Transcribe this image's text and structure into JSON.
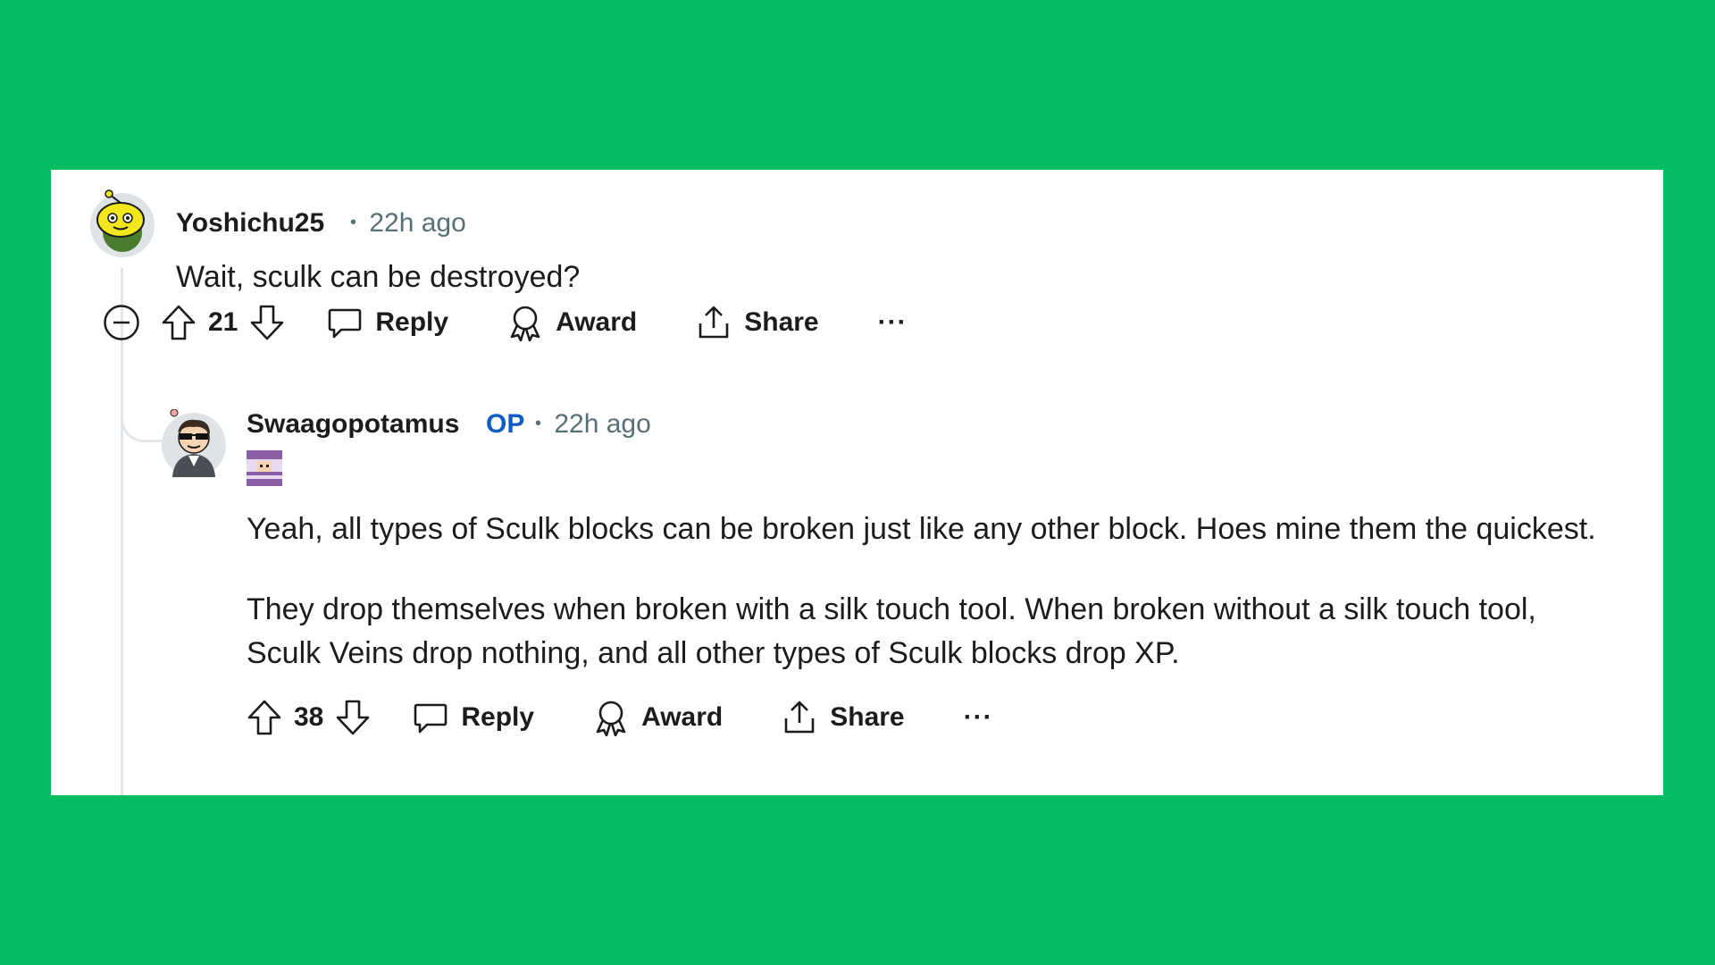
{
  "comments": [
    {
      "username": "Yoshichu25",
      "timestamp": "22h ago",
      "body": [
        "Wait, sculk can be destroyed?"
      ],
      "score": "21",
      "actions": {
        "reply": "Reply",
        "award": "Award",
        "share": "Share",
        "more": "···"
      }
    },
    {
      "username": "Swaagopotamus",
      "op_badge": "OP",
      "timestamp": "22h ago",
      "body": [
        "Yeah, all types of Sculk blocks can be broken just like any other block. Hoes mine them the quickest.",
        "They drop themselves when broken with a silk touch tool. When broken without a silk touch tool, Sculk Veins drop nothing, and all other types of Sculk blocks drop XP."
      ],
      "score": "38",
      "actions": {
        "reply": "Reply",
        "award": "Award",
        "share": "Share",
        "more": "···"
      }
    }
  ],
  "separator": "•",
  "colors": {
    "background": "#02bd63",
    "card": "#ffffff",
    "text": "#1c1c1c",
    "meta": "#576f76",
    "op": "#0f5cc9"
  }
}
